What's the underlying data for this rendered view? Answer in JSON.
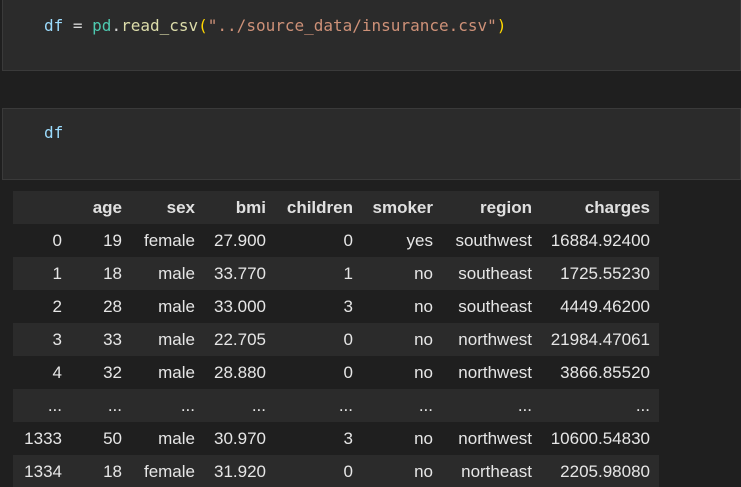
{
  "cells": [
    {
      "tokens": [
        {
          "text": "df",
          "kind": "var"
        },
        {
          "text": " = ",
          "kind": "op"
        },
        {
          "text": "pd",
          "kind": "mod"
        },
        {
          "text": ".",
          "kind": "op"
        },
        {
          "text": "read_csv",
          "kind": "fn"
        },
        {
          "text": "(",
          "kind": "paren"
        },
        {
          "text": "\"../source_data/insurance.csv\"",
          "kind": "str"
        },
        {
          "text": ")",
          "kind": "paren"
        }
      ]
    },
    {
      "tokens": [
        {
          "text": "df",
          "kind": "var"
        }
      ]
    }
  ],
  "table": {
    "columns": [
      "",
      "age",
      "sex",
      "bmi",
      "children",
      "smoker",
      "region",
      "charges"
    ],
    "rows": [
      [
        "0",
        "19",
        "female",
        "27.900",
        "0",
        "yes",
        "southwest",
        "16884.92400"
      ],
      [
        "1",
        "18",
        "male",
        "33.770",
        "1",
        "no",
        "southeast",
        "1725.55230"
      ],
      [
        "2",
        "28",
        "male",
        "33.000",
        "3",
        "no",
        "southeast",
        "4449.46200"
      ],
      [
        "3",
        "33",
        "male",
        "22.705",
        "0",
        "no",
        "northwest",
        "21984.47061"
      ],
      [
        "4",
        "32",
        "male",
        "28.880",
        "0",
        "no",
        "northwest",
        "3866.85520"
      ],
      [
        "...",
        "...",
        "...",
        "...",
        "...",
        "...",
        "...",
        "..."
      ],
      [
        "1333",
        "50",
        "male",
        "30.970",
        "3",
        "no",
        "northwest",
        "10600.54830"
      ],
      [
        "1334",
        "18",
        "female",
        "31.920",
        "0",
        "no",
        "northeast",
        "2205.98080"
      ]
    ]
  },
  "colors": {
    "background": "#1f1f1f",
    "cell_background": "#2b2b2b",
    "variable": "#9cdcfe",
    "module": "#4ec9b0",
    "function": "#dcdcaa",
    "paren": "#ffd700",
    "string": "#ce9178"
  }
}
